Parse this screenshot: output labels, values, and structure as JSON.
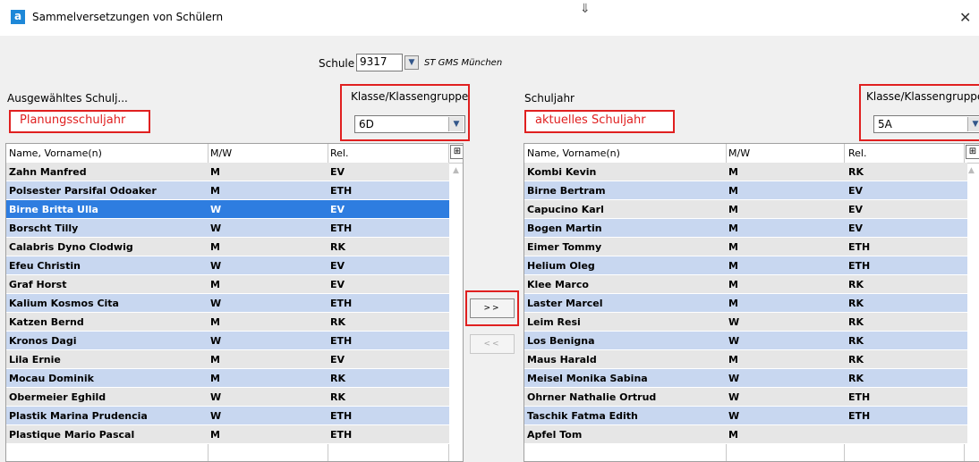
{
  "window": {
    "title": "Sammelversetzungen von Schülern",
    "app_icon": "a"
  },
  "school": {
    "label": "Schule",
    "code": "9317",
    "name": "ST GMS München"
  },
  "left": {
    "section_label": "Ausgewähltes Schulj...",
    "annotation": "Planungsschuljahr",
    "class_label": "Klasse/Klassengruppe",
    "class_value": "6D",
    "columns": [
      "Name, Vorname(n)",
      "M/W",
      "Rel."
    ],
    "rows": [
      {
        "name": "Zahn Manfred",
        "mw": "M",
        "rel": "EV"
      },
      {
        "name": "Polsester Parsifal Odoaker",
        "mw": "M",
        "rel": "ETH"
      },
      {
        "name": "Birne Britta Ulla",
        "mw": "W",
        "rel": "EV"
      },
      {
        "name": "Borscht Tilly",
        "mw": "W",
        "rel": "ETH"
      },
      {
        "name": "Calabris Dyno Clodwig",
        "mw": "M",
        "rel": "RK"
      },
      {
        "name": "Efeu Christin",
        "mw": "W",
        "rel": "EV"
      },
      {
        "name": "Graf Horst",
        "mw": "M",
        "rel": "EV"
      },
      {
        "name": "Kalium Kosmos Cita",
        "mw": "W",
        "rel": "ETH"
      },
      {
        "name": "Katzen Bernd",
        "mw": "M",
        "rel": "RK"
      },
      {
        "name": "Kronos Dagi",
        "mw": "W",
        "rel": "ETH"
      },
      {
        "name": "Lila Ernie",
        "mw": "M",
        "rel": "EV"
      },
      {
        "name": "Mocau Dominik",
        "mw": "M",
        "rel": "RK"
      },
      {
        "name": "Obermeier Eghild",
        "mw": "W",
        "rel": "RK"
      },
      {
        "name": "Plastik Marina Prudencia",
        "mw": "W",
        "rel": "ETH"
      },
      {
        "name": "Plastique Mario Pascal",
        "mw": "M",
        "rel": "ETH"
      }
    ]
  },
  "right": {
    "section_label": "Schuljahr",
    "annotation": "aktuelles Schuljahr",
    "class_label": "Klasse/Klassengruppe",
    "class_value": "5A",
    "columns": [
      "Name, Vorname(n)",
      "M/W",
      "Rel."
    ],
    "rows": [
      {
        "name": "Kombi Kevin",
        "mw": "M",
        "rel": "RK"
      },
      {
        "name": "Birne Bertram",
        "mw": "M",
        "rel": "EV"
      },
      {
        "name": "Capucino Karl",
        "mw": "M",
        "rel": "EV"
      },
      {
        "name": "Bogen Martin",
        "mw": "M",
        "rel": "EV"
      },
      {
        "name": "Eimer Tommy",
        "mw": "M",
        "rel": "ETH"
      },
      {
        "name": "Helium Oleg",
        "mw": "M",
        "rel": "ETH"
      },
      {
        "name": "Klee Marco",
        "mw": "M",
        "rel": "RK"
      },
      {
        "name": "Laster Marcel",
        "mw": "M",
        "rel": "RK"
      },
      {
        "name": "Leim Resi",
        "mw": "W",
        "rel": "RK"
      },
      {
        "name": "Los Benigna",
        "mw": "W",
        "rel": "RK"
      },
      {
        "name": "Maus Harald",
        "mw": "M",
        "rel": "RK"
      },
      {
        "name": "Meisel Monika Sabina",
        "mw": "W",
        "rel": "RK"
      },
      {
        "name": "Ohrner Nathalie Ortrud",
        "mw": "W",
        "rel": "ETH"
      },
      {
        "name": "Taschik Fatma Edith",
        "mw": "W",
        "rel": "ETH"
      },
      {
        "name": "Apfel Tom",
        "mw": "M",
        "rel": ""
      }
    ]
  },
  "buttons": {
    "move_right": ">>",
    "move_left": "<<"
  },
  "colors": {
    "annotation_red": "#e02020",
    "row_blue": "#c8d7f0",
    "row_gray": "#e6e6e6",
    "selected": "#2e7de0"
  }
}
